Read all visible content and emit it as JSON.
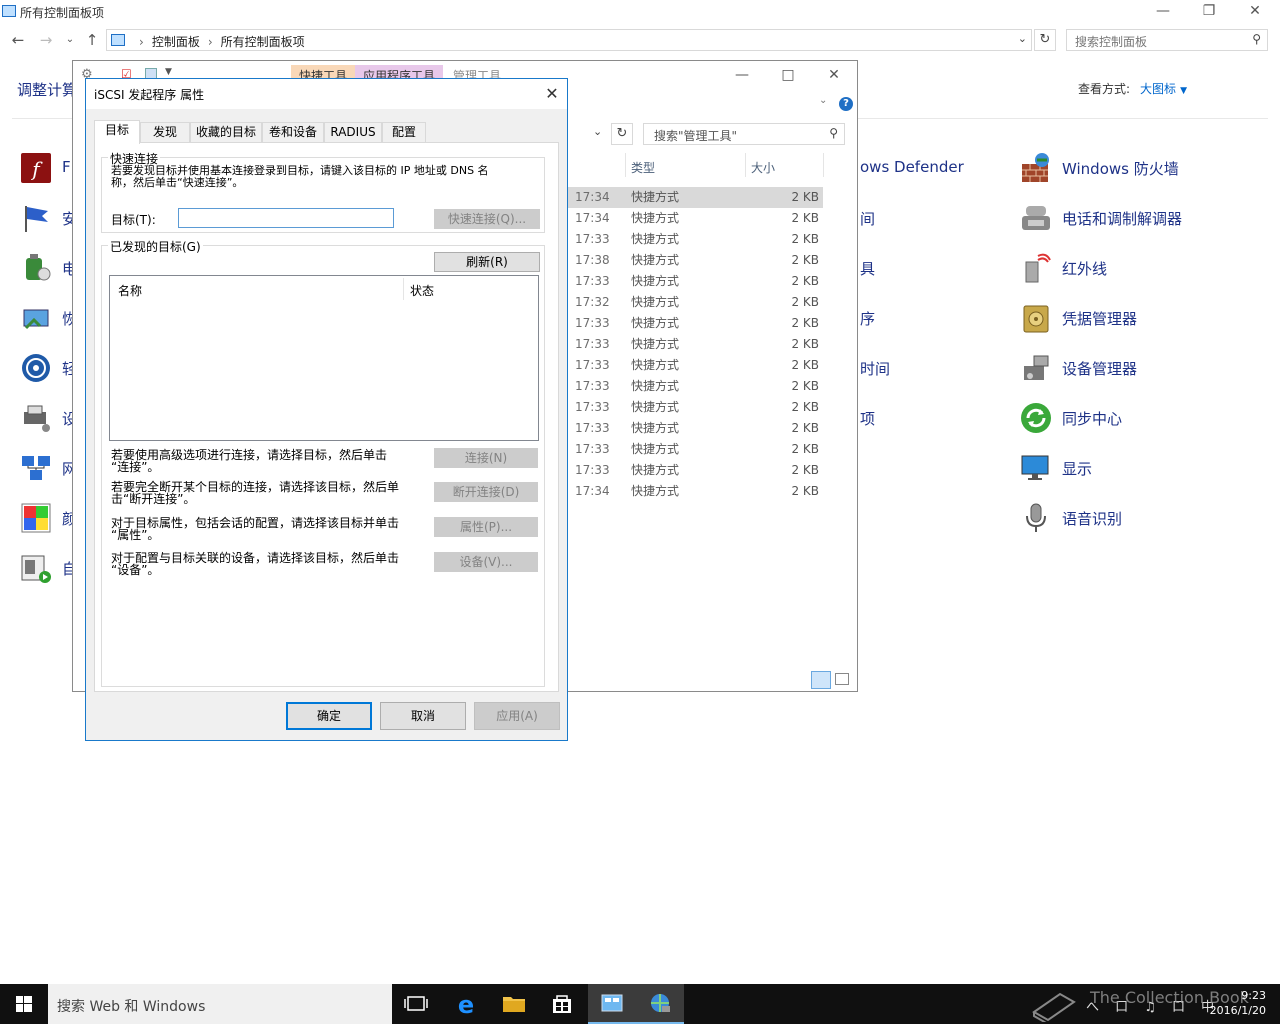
{
  "control_panel": {
    "title": "所有控制面板项",
    "breadcrumb": [
      "控制面板",
      "所有控制面板项"
    ],
    "search_placeholder": "搜索控制面板",
    "heading": "调整计算机的设置",
    "view_by_label": "查看方式:",
    "view_by_value": "大图标",
    "left_items": [
      "F",
      "安",
      "电",
      "恢",
      "轻",
      "设",
      "网",
      "颜",
      "自"
    ],
    "middle_items": [
      "ows Defender",
      "间",
      "具",
      "序",
      "时间",
      "项"
    ],
    "right_items": [
      "Windows 防火墙",
      "电话和调制解调器",
      "红外线",
      "凭据管理器",
      "设备管理器",
      "同步中心",
      "显示",
      "语音识别"
    ]
  },
  "explorer": {
    "ribbon_tabs": [
      "快捷工具",
      "应用程序工具",
      "管理工具"
    ],
    "search_placeholder": "搜索\"管理工具\"",
    "columns": {
      "type": "类型",
      "size": "大小"
    },
    "rows": [
      {
        "time": "17:34",
        "type": "快捷方式",
        "size": "2 KB",
        "selected": true
      },
      {
        "time": "17:34",
        "type": "快捷方式",
        "size": "2 KB"
      },
      {
        "time": "17:33",
        "type": "快捷方式",
        "size": "2 KB"
      },
      {
        "time": "17:38",
        "type": "快捷方式",
        "size": "2 KB"
      },
      {
        "time": "17:33",
        "type": "快捷方式",
        "size": "2 KB"
      },
      {
        "time": "17:32",
        "type": "快捷方式",
        "size": "2 KB"
      },
      {
        "time": "17:33",
        "type": "快捷方式",
        "size": "2 KB"
      },
      {
        "time": "17:33",
        "type": "快捷方式",
        "size": "2 KB"
      },
      {
        "time": "17:33",
        "type": "快捷方式",
        "size": "2 KB"
      },
      {
        "time": "17:33",
        "type": "快捷方式",
        "size": "2 KB"
      },
      {
        "time": "17:33",
        "type": "快捷方式",
        "size": "2 KB"
      },
      {
        "time": "17:33",
        "type": "快捷方式",
        "size": "2 KB"
      },
      {
        "time": "17:33",
        "type": "快捷方式",
        "size": "2 KB"
      },
      {
        "time": "17:33",
        "type": "快捷方式",
        "size": "2 KB"
      },
      {
        "time": "17:34",
        "type": "快捷方式",
        "size": "2 KB"
      }
    ]
  },
  "dialog": {
    "title": "iSCSI 发起程序 属性",
    "tabs": [
      "目标",
      "发现",
      "收藏的目标",
      "卷和设备",
      "RADIUS",
      "配置"
    ],
    "quick_connect": {
      "group_title": "快速连接",
      "desc_line1": "若要发现目标并使用基本连接登录到目标，请键入该目标的 IP 地址或 DNS 名",
      "desc_line2": "称，然后单击“快速连接”。",
      "target_label": "目标(T):",
      "target_value": "",
      "button": "快速连接(Q)..."
    },
    "discovered": {
      "group_title": "已发现的目标(G)",
      "refresh_button": "刷新(R)",
      "col_name": "名称",
      "col_status": "状态"
    },
    "actions": [
      {
        "line1": "若要使用高级选项进行连接，请选择目标，然后单击",
        "line2": "“连接”。",
        "button": "连接(N)"
      },
      {
        "line1": "若要完全断开某个目标的连接，请选择该目标，然后单",
        "line2": "击“断开连接”。",
        "button": "断开连接(D)"
      },
      {
        "line1": "对于目标属性，包括会话的配置，请选择该目标并单击",
        "line2": "“属性”。",
        "button": "属性(P)..."
      },
      {
        "line1": "对于配置与目标关联的设备，请选择该目标，然后单击",
        "line2": "“设备”。",
        "button": "设备(V)..."
      }
    ],
    "ok": "确定",
    "cancel": "取消",
    "apply": "应用(A)"
  },
  "taskbar": {
    "search_placeholder": "搜索 Web 和 Windows",
    "time": "9:23",
    "date": "2016/1/20",
    "tray_text": "へ 口 ♫ 口 中",
    "watermark": "The Collection Book"
  }
}
